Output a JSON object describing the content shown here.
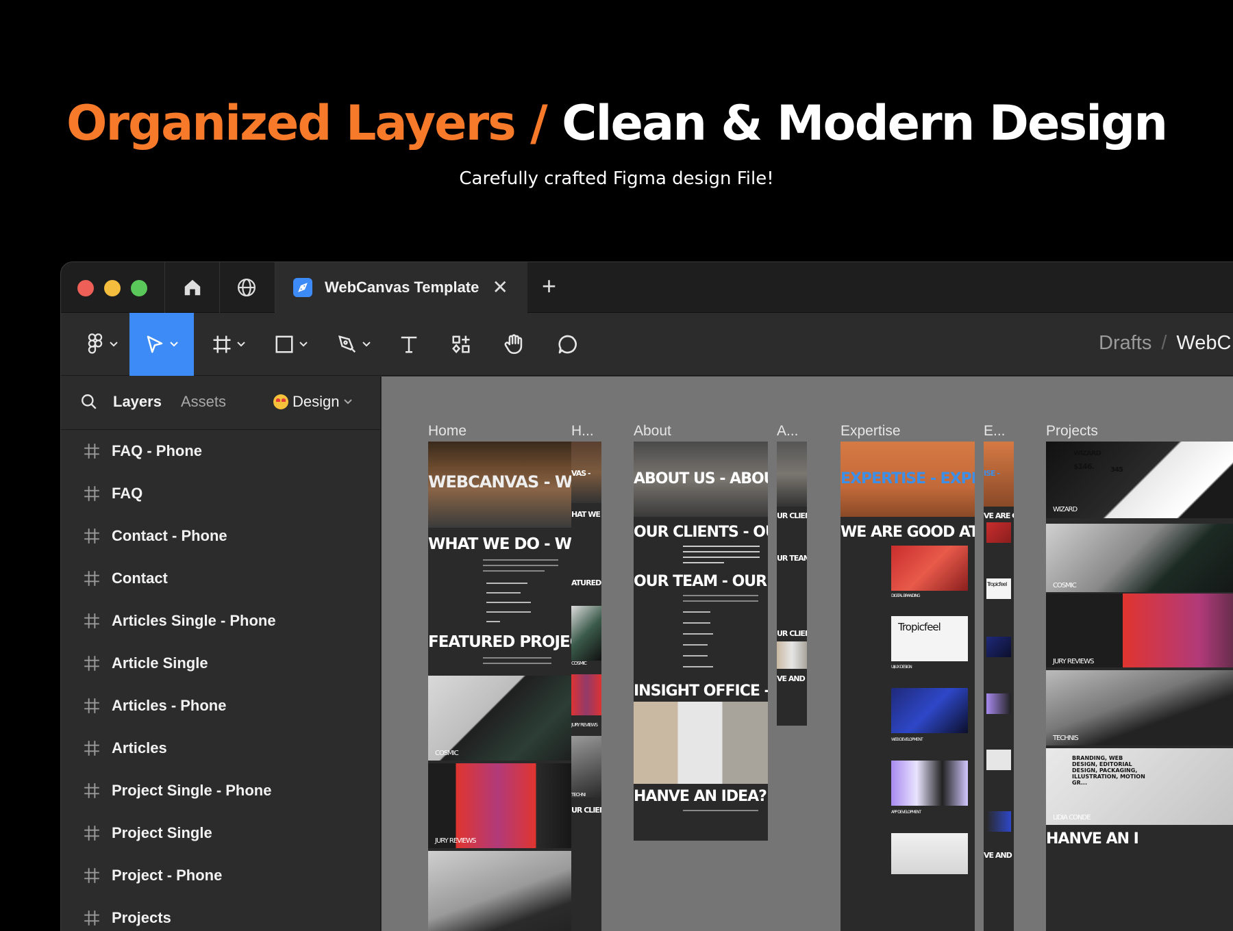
{
  "hero": {
    "title_accent": "Organized Layers /",
    "title_rest": "Clean & Modern Design",
    "subtitle": "Carefully crafted Figma design File!"
  },
  "tabbar": {
    "home_icon": "home-icon",
    "community_icon": "globe-icon",
    "active_tab_title": "WebCanvas Template",
    "close_symbol": "✕",
    "new_tab_symbol": "+"
  },
  "toolbar": {
    "tools": [
      "figma-menu",
      "move",
      "frame",
      "shape",
      "pen",
      "text",
      "resources",
      "hand",
      "comment"
    ],
    "active_tool": "move",
    "breadcrumb_root": "Drafts",
    "breadcrumb_sep": "/",
    "breadcrumb_file": "WebC"
  },
  "sidebar": {
    "tab_layers": "Layers",
    "tab_assets": "Assets",
    "page_selector": "Design",
    "layers": [
      "FAQ - Phone",
      "FAQ",
      "Contact - Phone",
      "Contact",
      "Articles Single - Phone",
      "Article Single",
      "Articles - Phone",
      "Articles",
      "Project Single - Phone",
      "Project Single",
      "Project - Phone",
      "Projects"
    ]
  },
  "canvas": {
    "frame_labels": [
      "Home",
      "H...",
      "About",
      "A...",
      "Expertise",
      "E...",
      "Projects"
    ],
    "home": {
      "hero": "WEBCANVAS - WEB",
      "s1": "WHAT WE DO - WHA",
      "s2": "FEATURED PROJECT",
      "cosmic": "COSMIC",
      "jury": "JURY REVIEWS"
    },
    "home_phone": {
      "hero": "VAS -",
      "s1": "HAT WE D",
      "s2": "ATURED P",
      "cosmic": "COSMIC",
      "jury": "JURY REVIEWS",
      "techni": "TECHNI",
      "clients": "UR CLIENT"
    },
    "about": {
      "hero": "ABOUT US - ABOUT",
      "s1": "OUR CLIENTS - OUR",
      "s1_body": "GOOGLE / MICROSOFT / AMAZON / APPLE / GUCCI / RAYBAN / BEHANCE / DRIBBLE / FACEBOOK / LEVIS / OUTFITTERS / TESLA / IBA / VERIZON / TIKTOK / LENSKART / RELIANCE / LINKEDIN",
      "s2": "OUR TEAM - OUR TE",
      "team": [
        "HARRY CELLER",
        "LUNA WILLIAM",
        "ANTHONY JAMES",
        "KEVIN CLARK",
        "SELENA MIKE",
        "JENNY GROOVE"
      ],
      "s3": "INSIGHT OFFICE - INS",
      "s4": "HANVE AN IDEA? - H"
    },
    "about_phone": {
      "s1": "UR CLIEN",
      "s2": "UR TEAM",
      "s3": "UR CLIEN",
      "s4": "VE AND II"
    },
    "expertise": {
      "hero": "EXPERTISE - EXPERT",
      "s1": "WE ARE GOOD AT - W",
      "items": [
        "DIGITAL BRANDING",
        "UI/UX DESIGN",
        "WEB DEVELOPMENT",
        "APP DEVELOPMENT"
      ],
      "tropicfeel": "Tropicfeel"
    },
    "expertise_phone": {
      "hero": "ISE -",
      "s1": "VE ARE GO",
      "tropicfeel": "Tropicfeel",
      "s2": "VE AND II"
    },
    "projects": {
      "wizard": "WIZARD",
      "price": "$146.",
      "price2": "345",
      "cosmic": "COSMIC",
      "jury": "JURY REVIEWS",
      "techni": "TECHNIS",
      "lidia": "LIDIA CONDE",
      "lidia_body": "BRANDING, WEB DESIGN, EDITORIAL DESIGN, PACKAGING, ILLUSTRATION, MOTION GR...",
      "s_last": "HANVE AN I"
    }
  },
  "colors": {
    "accent_orange": "#f77a2a",
    "selection_blue": "#3d8bf7",
    "traffic_red": "#ed5f57",
    "traffic_yellow": "#f5bd3e",
    "traffic_green": "#5ac75a",
    "canvas_bg": "#757575",
    "panel_bg": "#2c2c2c"
  }
}
